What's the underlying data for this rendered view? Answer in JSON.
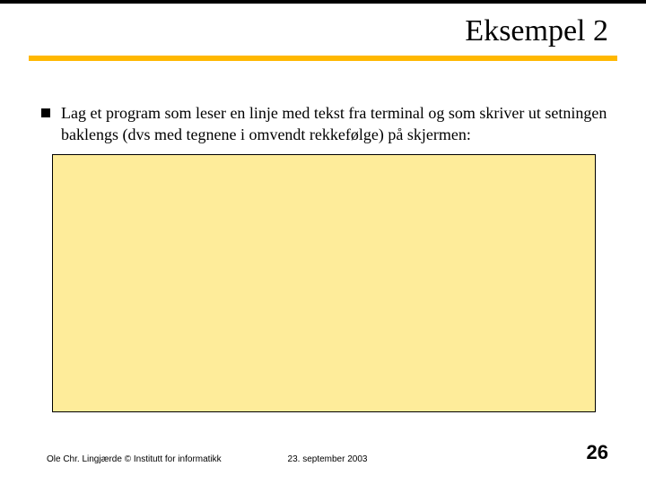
{
  "slide": {
    "title": "Eksempel 2",
    "bullet": "Lag et program som leser en linje med tekst fra terminal og som skriver ut setningen baklengs (dvs med tegnene i omvendt rekkefølge) på skjermen:"
  },
  "footer": {
    "author": "Ole Chr. Lingjærde © Institutt for informatikk",
    "date": "23. september 2003",
    "page": "26"
  },
  "colors": {
    "accent_orange": "#ffb800",
    "code_box_bg": "#feec9a"
  }
}
